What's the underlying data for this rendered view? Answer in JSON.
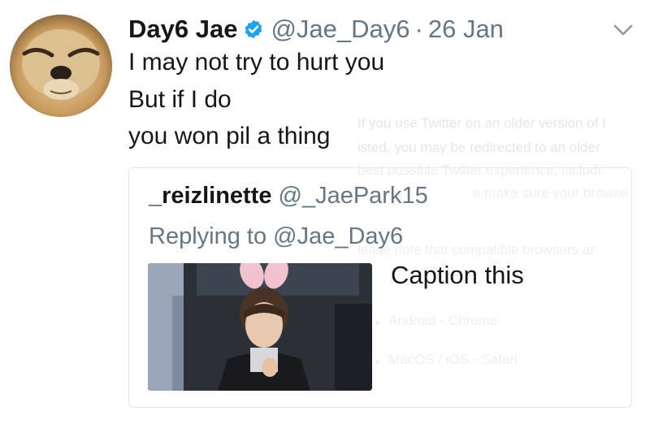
{
  "author": {
    "display_name": "Day6 Jae",
    "handle": "@Jae_Day6",
    "separator": "·",
    "date": "26 Jan",
    "verified": true
  },
  "tweet": {
    "lines": [
      "I may not try to hurt you",
      "But if I do",
      "you won pil a thing"
    ]
  },
  "quoted": {
    "display_name": "_reizlinette",
    "handle": "@_JaePark15",
    "replying_to": "Replying to @Jae_Day6",
    "caption": "Caption this"
  },
  "background_overlay": {
    "lines": [
      "If you use Twitter on an older version of t",
      "isted, you may be redirected to an older",
      "best possible Twitter experience, includi",
      "e make sure your browse",
      "lease note that compatible browsers ar",
      "Android - Chrome",
      "MacOS / iOS - Safari"
    ]
  },
  "colors": {
    "text_primary": "#14171a",
    "text_secondary": "#657786",
    "verified_blue": "#1da1f2",
    "border": "#e1e8ed"
  },
  "icons": [
    "verified-badge-icon",
    "chevron-down-icon"
  ]
}
